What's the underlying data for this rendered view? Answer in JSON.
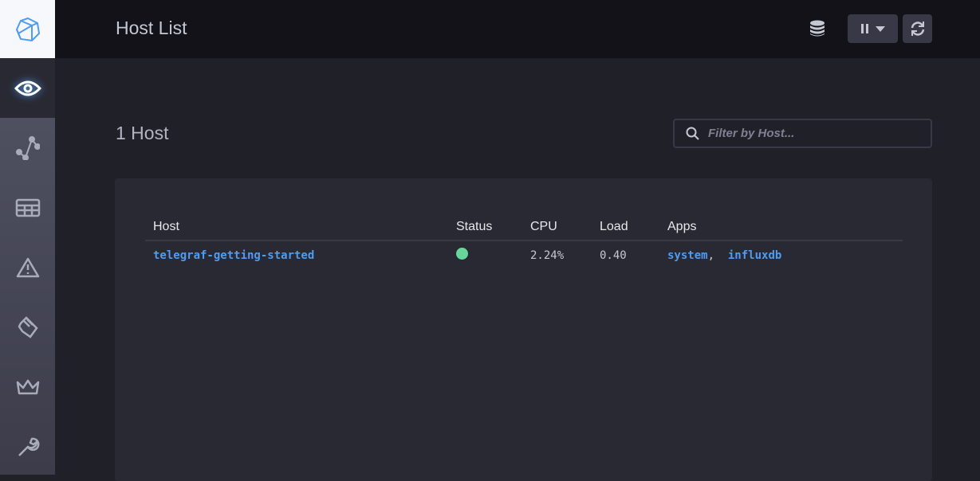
{
  "header": {
    "title": "Host List"
  },
  "main": {
    "count": "1 Host",
    "filter_placeholder": "Filter by Host...",
    "filter_value": ""
  },
  "table": {
    "columns": [
      "Host",
      "Status",
      "CPU",
      "Load",
      "Apps"
    ],
    "rows": [
      {
        "host": "telegraf-getting-started",
        "status": "online",
        "cpu": "2.24%",
        "load": "0.40",
        "apps": [
          "system",
          "influxdb"
        ],
        "separator": ","
      }
    ]
  },
  "colors": {
    "status_online": "#67d69b",
    "link": "#4f9cf0",
    "accent": "#4f9cf0"
  },
  "sidebar": {
    "items": [
      "host-list",
      "data-explorer",
      "dashboards",
      "alerting",
      "log-viewer",
      "admin",
      "configuration"
    ],
    "active": "host-list"
  }
}
